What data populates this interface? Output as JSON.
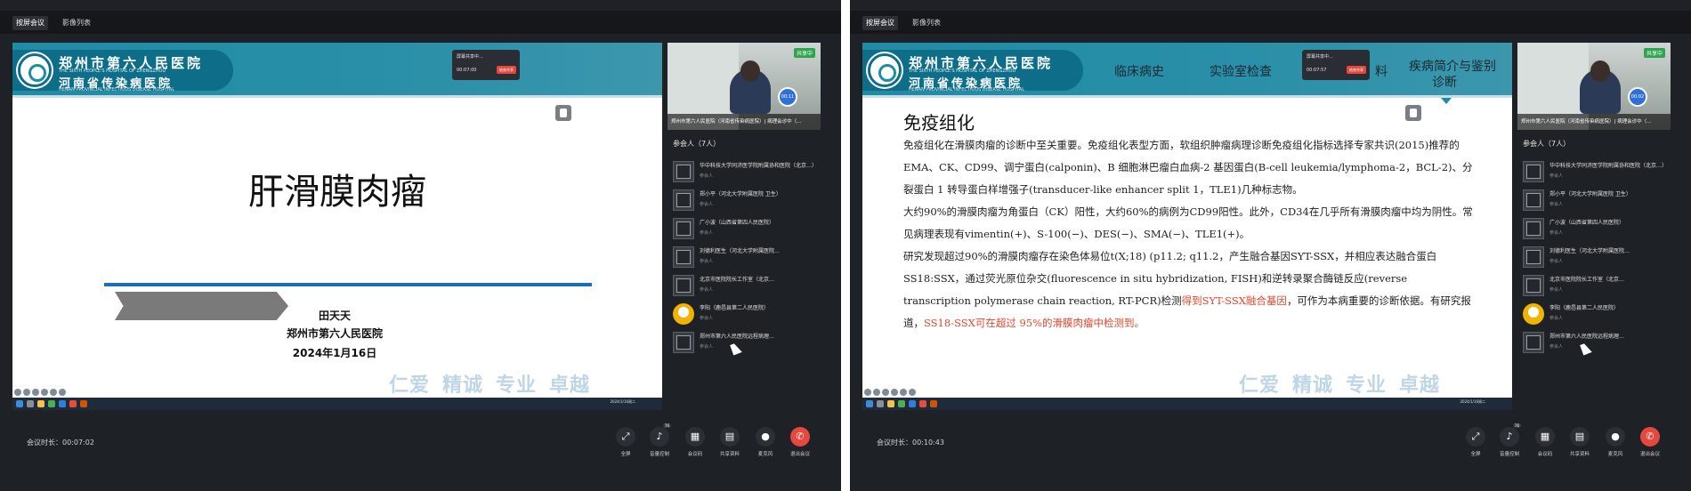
{
  "tabs": [
    "按屏会议",
    "影像列表"
  ],
  "hospital": {
    "name_cn": "郑州市第六人民医院",
    "name_en": "THE SIXTH PEOPLE'S HOSPITAL OF ZHENGZHOU",
    "name2_cn": "河南省传染病医院",
    "name2_en": "HENAN PROVINCIAL INFECTIOUS DISEASE HOSPITAL"
  },
  "popup": {
    "title": "屏幕共享中...",
    "timer": "00:07:00",
    "timer2": "00:07:57",
    "btn": "结束共享"
  },
  "mottos": [
    "仁爱",
    "精诚",
    "专业",
    "卓越"
  ],
  "window1": {
    "slide": {
      "title": "肝滑膜肉瘤",
      "presenter": "田天天",
      "hospital": "郑州市第六人民医院",
      "date": "2024年1月16日"
    },
    "duration_label": "会议时长：",
    "duration": "00:07:02",
    "taskbar_time": "2024/1/16周二"
  },
  "window2": {
    "slide": {
      "nav": [
        "临床病史",
        "实验室检查",
        "料",
        "疾病简介与鉴别",
        "诊断"
      ],
      "heading": "免疫组化",
      "p1": "免疫组化在滑膜肉瘤的诊断中至关重要。免疫组化表型方面，软组织肿瘤病理诊断免疫组化指标选择专家共识(2015)推荐的 EMA、CK、CD99、调宁蛋白(calponin)、B 细胞淋巴瘤白血病-2 基因蛋白(B-cell leukemia/lymphoma-2，BCL-2)、分裂蛋白 1 转导蛋白样增强子(transducer-like enhancer split 1，TLE1)几种标志物。",
      "p2": "大约90%的滑膜肉瘤为角蛋白（CK）阳性，大约60%的病例为CD99阳性。此外，CD34在几乎所有滑膜肉瘤中均为阴性。常见病理表现有vimentin(+)、S-100(−)、DES(−)、SMA(−)、TLE1(+)。",
      "p3_a": "研究发现超过90%的滑膜肉瘤存在染色体易位t(X;18) (p11.2; q11.2，产生融合基因SYT-SSX，并相应表达融合蛋白SS18:SSX，通过荧光原位杂交(fluorescence in situ hybridization, FISH)和逆转录聚合酶链反应(reverse transcription polymerase chain reaction, RT-PCR)检测",
      "p3_red1": "得到SYT-SSX融合基因",
      "p3_b": "，可作为本病重要的诊断依据。有研究报道，",
      "p3_red2": "SS18-SSX可在超过 95%的滑膜肉瘤中检测到。"
    },
    "duration_label": "会议时长：",
    "duration": "00:10:43",
    "taskbar_time": "2024/1/16周二"
  },
  "video": {
    "share_tag": "共享中",
    "caption": "郑州市第六人民医院（河南省传染病医院）| 病理会诊中（…",
    "mic_badge1": "00:11",
    "mic_badge2": "00:02"
  },
  "participants": {
    "header": "参会人（7人）",
    "role": "参会人",
    "list": [
      {
        "name": "华中科技大学同济医学院附属协和医院（北京…）",
        "type": "default"
      },
      {
        "name": "郑小平（河北大学附属医院 卫生）",
        "type": "default"
      },
      {
        "name": "广小波（山西省第四人民医院）",
        "type": "default"
      },
      {
        "name": "刘德利医生（河北大学附属医院…",
        "type": "default"
      },
      {
        "name": "北京市医院院长工作室（北京…",
        "type": "default"
      },
      {
        "name": "李阳（鹿邑县第二人民医院）",
        "type": "user"
      },
      {
        "name": "郑州市第六人民医院远程病理…",
        "type": "default"
      }
    ]
  },
  "controls": [
    {
      "label": "全屏",
      "icon": "⤢"
    },
    {
      "label": "音量控制",
      "icon": "♪",
      "badge": "76"
    },
    {
      "label": "会议码",
      "icon": "▦"
    },
    {
      "label": "共享资料",
      "icon": "▤"
    },
    {
      "label": "麦克风",
      "icon": "●"
    },
    {
      "label": "退出会议",
      "icon": "✆"
    }
  ],
  "colors": {
    "end_button": "#e5483e",
    "header_teal": "#1f8ca6",
    "accent_red": "#e5452b"
  }
}
